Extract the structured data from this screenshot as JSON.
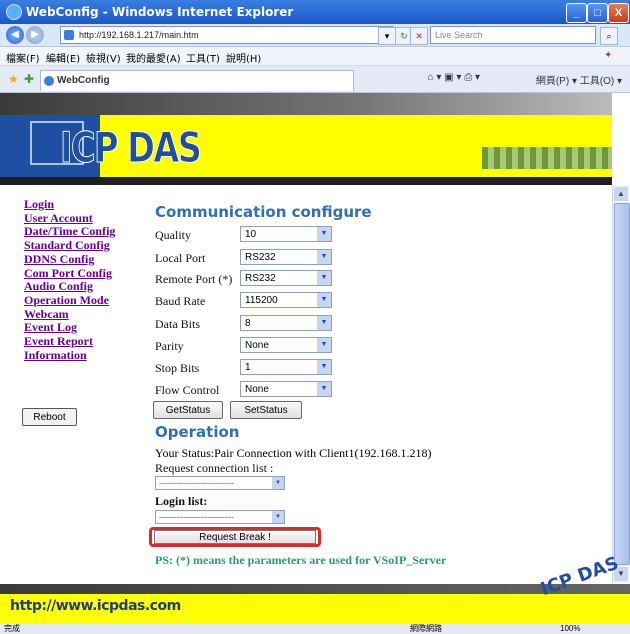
{
  "window": {
    "title": "WebConfig - Windows Internet Explorer",
    "min": "_",
    "max": "□",
    "close": "X"
  },
  "address": {
    "back": "◀",
    "forward": "▶",
    "url": "http://192.168.1.217/main.htm",
    "search_placeholder": "Live Search"
  },
  "menu": [
    "檔案(F)",
    "編輯(E)",
    "檢視(V)",
    "我的最愛(A)",
    "工具(T)",
    "說明(H)"
  ],
  "tab": {
    "label": "WebConfig"
  },
  "toolbar": {
    "right": "網頁(P) ▾  工具(O) ▾"
  },
  "banner": {
    "logo": "ICP DAS"
  },
  "sidebar": {
    "links": [
      "Login",
      "User Account",
      "Date/Time Config",
      "Standard Config",
      "DDNS Config",
      "Com Port Config",
      "Audio Config",
      "Operation Mode",
      "Webcam",
      "Event Log",
      "Event Report",
      "Information"
    ],
    "reboot": "Reboot"
  },
  "comm": {
    "heading": "Communication configure",
    "rows": [
      {
        "label": "Quality",
        "value": "10"
      },
      {
        "label": "Local Port",
        "value": "RS232"
      },
      {
        "label": "Remote Port (*)",
        "value": "RS232"
      },
      {
        "label": "Baud Rate",
        "value": "115200"
      },
      {
        "label": "Data Bits",
        "value": "8"
      },
      {
        "label": "Parity",
        "value": "None"
      },
      {
        "label": "Stop Bits",
        "value": "1"
      },
      {
        "label": "Flow Control",
        "value": "None"
      }
    ],
    "get_status": "GetStatus",
    "set_status": "SetStatus"
  },
  "operation": {
    "heading": "Operation",
    "status": "Your Status:Pair Connection with Client1(192.168.1.218)",
    "request_label": "Request connection list :",
    "request_value": "-------------------------",
    "login_label": "Login list:",
    "login_value": "-------------------------",
    "break_button": "Request Break !",
    "note": "PS: (*) means the parameters are used for VSoIP_Server"
  },
  "footer": {
    "url": "http://www.icpdas.com",
    "mini_logo": "ICP DAS"
  },
  "statusbar": {
    "left": "完成",
    "zone": "網際網路",
    "zoom": "100%"
  }
}
